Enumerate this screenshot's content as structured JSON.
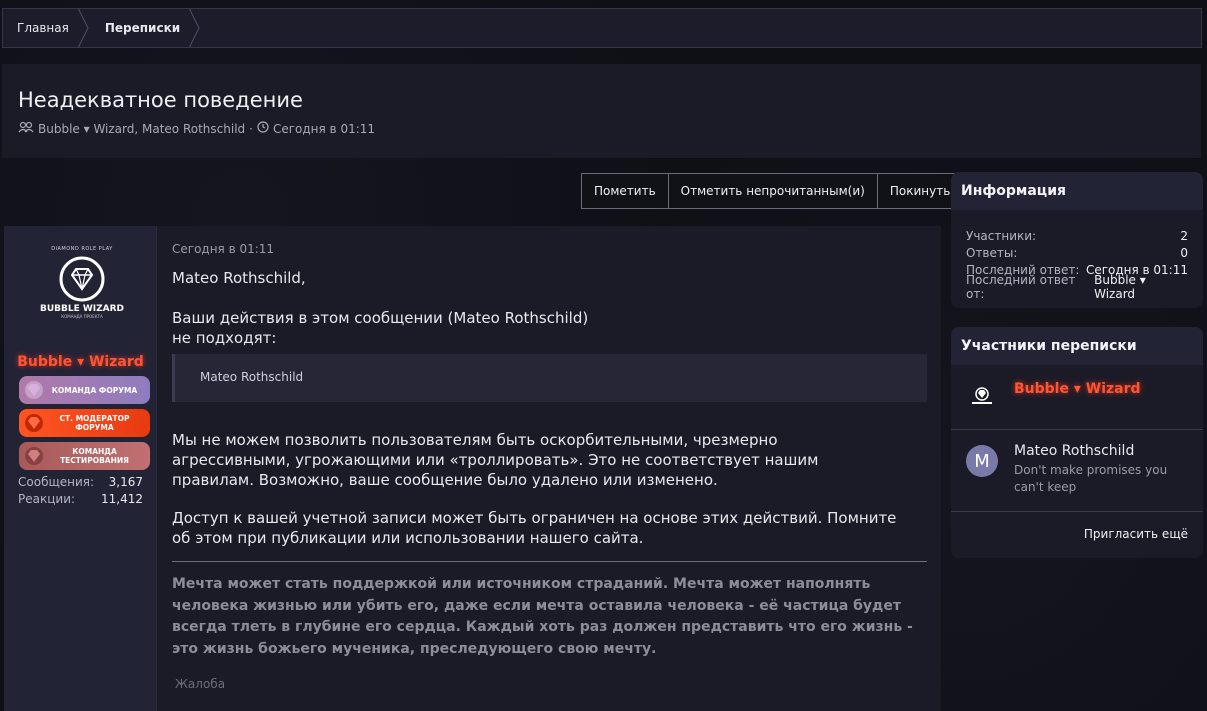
{
  "breadcrumb": {
    "home": "Главная",
    "current": "Переписки"
  },
  "thread": {
    "title": "Неадекватное поведение",
    "participants_text": "Bubble ▾ Wizard, Mateo Rothschild",
    "separator": "·",
    "date": "Сегодня в 01:11"
  },
  "actions": {
    "mark": "Пометить",
    "mark_unread": "Отметить непрочитанным(и)",
    "leave": "Покинуть"
  },
  "author": {
    "avatar_tiny": "DIAMOND ROLE PLAY",
    "avatar_name": "BUBBLE WIZARD",
    "avatar_sub": "КОМАНДА ПРОЕКТА",
    "name": "Bubble ▾ Wizard",
    "badges": [
      "КОМАНДА ФОРУМА",
      "СТ. МОДЕРАТОР ФОРУМА",
      "КОМАНДА ТЕСТИРОВАНИЯ"
    ],
    "messages_label": "Сообщения:",
    "messages_value": "3,167",
    "reactions_label": "Реакции:",
    "reactions_value": "11,412"
  },
  "message": {
    "date": "Сегодня в 01:11",
    "greeting": "Mateo Rothschild,",
    "line1": "Ваши действия в этом сообщении (Mateo Rothschild)",
    "line2": "не подходят:",
    "quote": "Mateo Rothschild",
    "para1": "Мы не можем позволить пользователям быть оскорбительными, чрезмерно агрессивными, угрожающими или «троллировать». Это не соответствует нашим правилам. Возможно, ваше сообщение было удалено или изменено.",
    "para2": "Доступ к вашей учетной записи может быть ограничен на основе этих действий. Помните об этом при публикации или использовании нашего сайта.",
    "signature": "Мечта может стать поддержкой или источником страданий. Мечта может наполнять человека жизнью или убить его, даже если мечта оставила человека - её частица будет всегда тлеть в глубине его сердца. Каждый хоть раз должен представить что его жизнь - это жизнь божьего мученика, преследующего свою мечту.",
    "report": "Жалоба"
  },
  "info": {
    "title": "Информация",
    "participants_label": "Участники:",
    "participants_value": "2",
    "replies_label": "Ответы:",
    "replies_value": "0",
    "last_reply_label": "Последний ответ:",
    "last_reply_value": "Сегодня в 01:11",
    "last_from_label": "Последний ответ от:",
    "last_from_value": "Bubble ▾ Wizard"
  },
  "participants": {
    "title": "Участники переписки",
    "p1_name": "Bubble ▾ Wizard",
    "p2_initial": "M",
    "p2_name": "Mateo Rothschild",
    "p2_status": "Don't make promises you can't keep",
    "invite": "Пригласить ещё"
  },
  "colors": {
    "accent_name": "#ff5533",
    "avatar_m": "#7a7aa8"
  }
}
